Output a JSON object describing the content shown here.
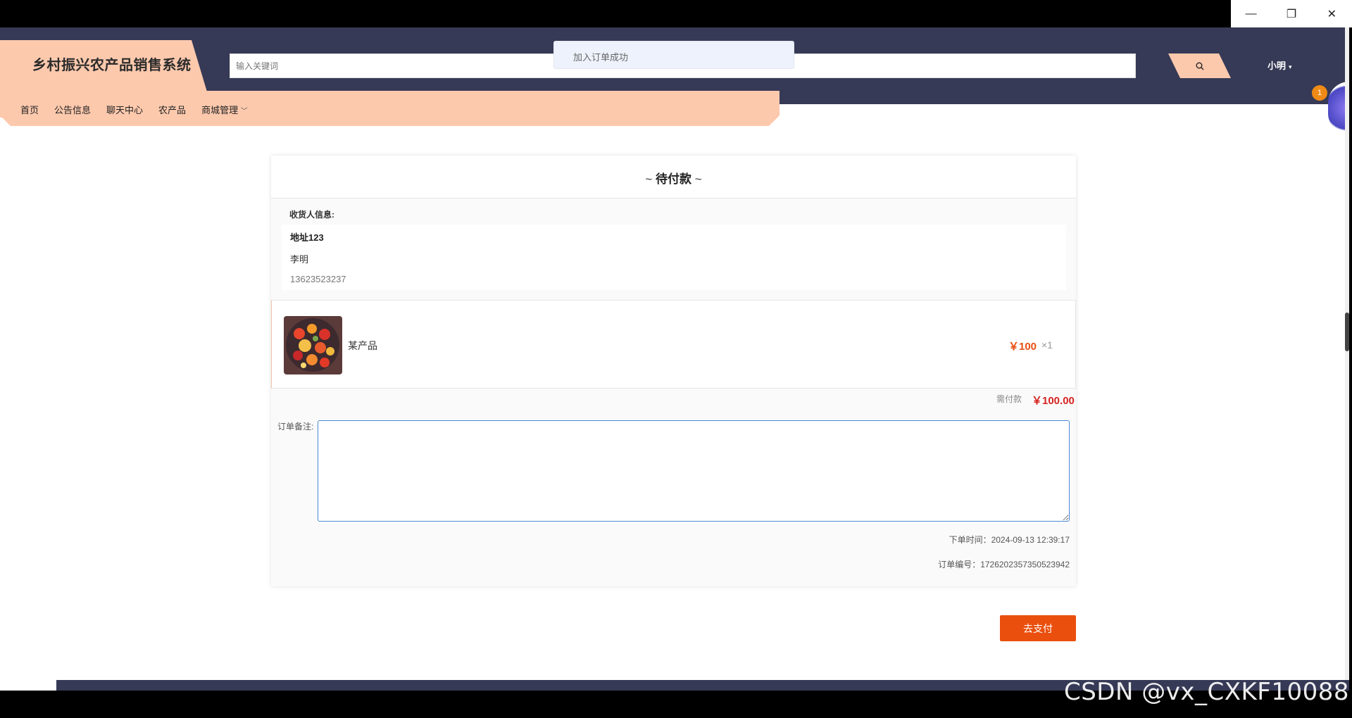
{
  "window": {
    "minimize_glyph": "—",
    "restore_glyph": "❐",
    "close_glyph": "✕"
  },
  "header": {
    "brand_title": "乡村振兴农产品销售系统",
    "search_placeholder": "输入关键词",
    "user_name": "小明",
    "user_caret": "▾"
  },
  "nav": {
    "items": [
      {
        "label": "首页"
      },
      {
        "label": "公告信息"
      },
      {
        "label": "聊天中心"
      },
      {
        "label": "农产品"
      },
      {
        "label": "商城管理"
      }
    ],
    "dropdown_caret": "﹀"
  },
  "toast": {
    "message": "加入订单成功"
  },
  "notification_badge": "1",
  "order": {
    "title": "待付款",
    "title_deco_left": "~",
    "title_deco_right": "~",
    "receiver_label": "收货人信息:",
    "address": "地址123",
    "receiver_name": "李明",
    "phone": "13623523237",
    "product": {
      "name": "某产品",
      "price": "￥100",
      "quantity": "×1"
    },
    "total_label": "需付款",
    "total_value": "￥100.00",
    "remark_label": "订单备注:",
    "remark_value": "",
    "order_time": "下单时间：2024-09-13 12:39:17",
    "order_number": "订单编号：1726202357350523942",
    "pay_button": "去支付"
  },
  "watermark": "CSDN @vx_CXKF10088",
  "colors": {
    "header_bg": "#363a56",
    "accent_peach": "#fdc9ad",
    "price_orange": "#e84e0f",
    "total_red": "#d62420",
    "pay_button": "#ea4f0d"
  }
}
